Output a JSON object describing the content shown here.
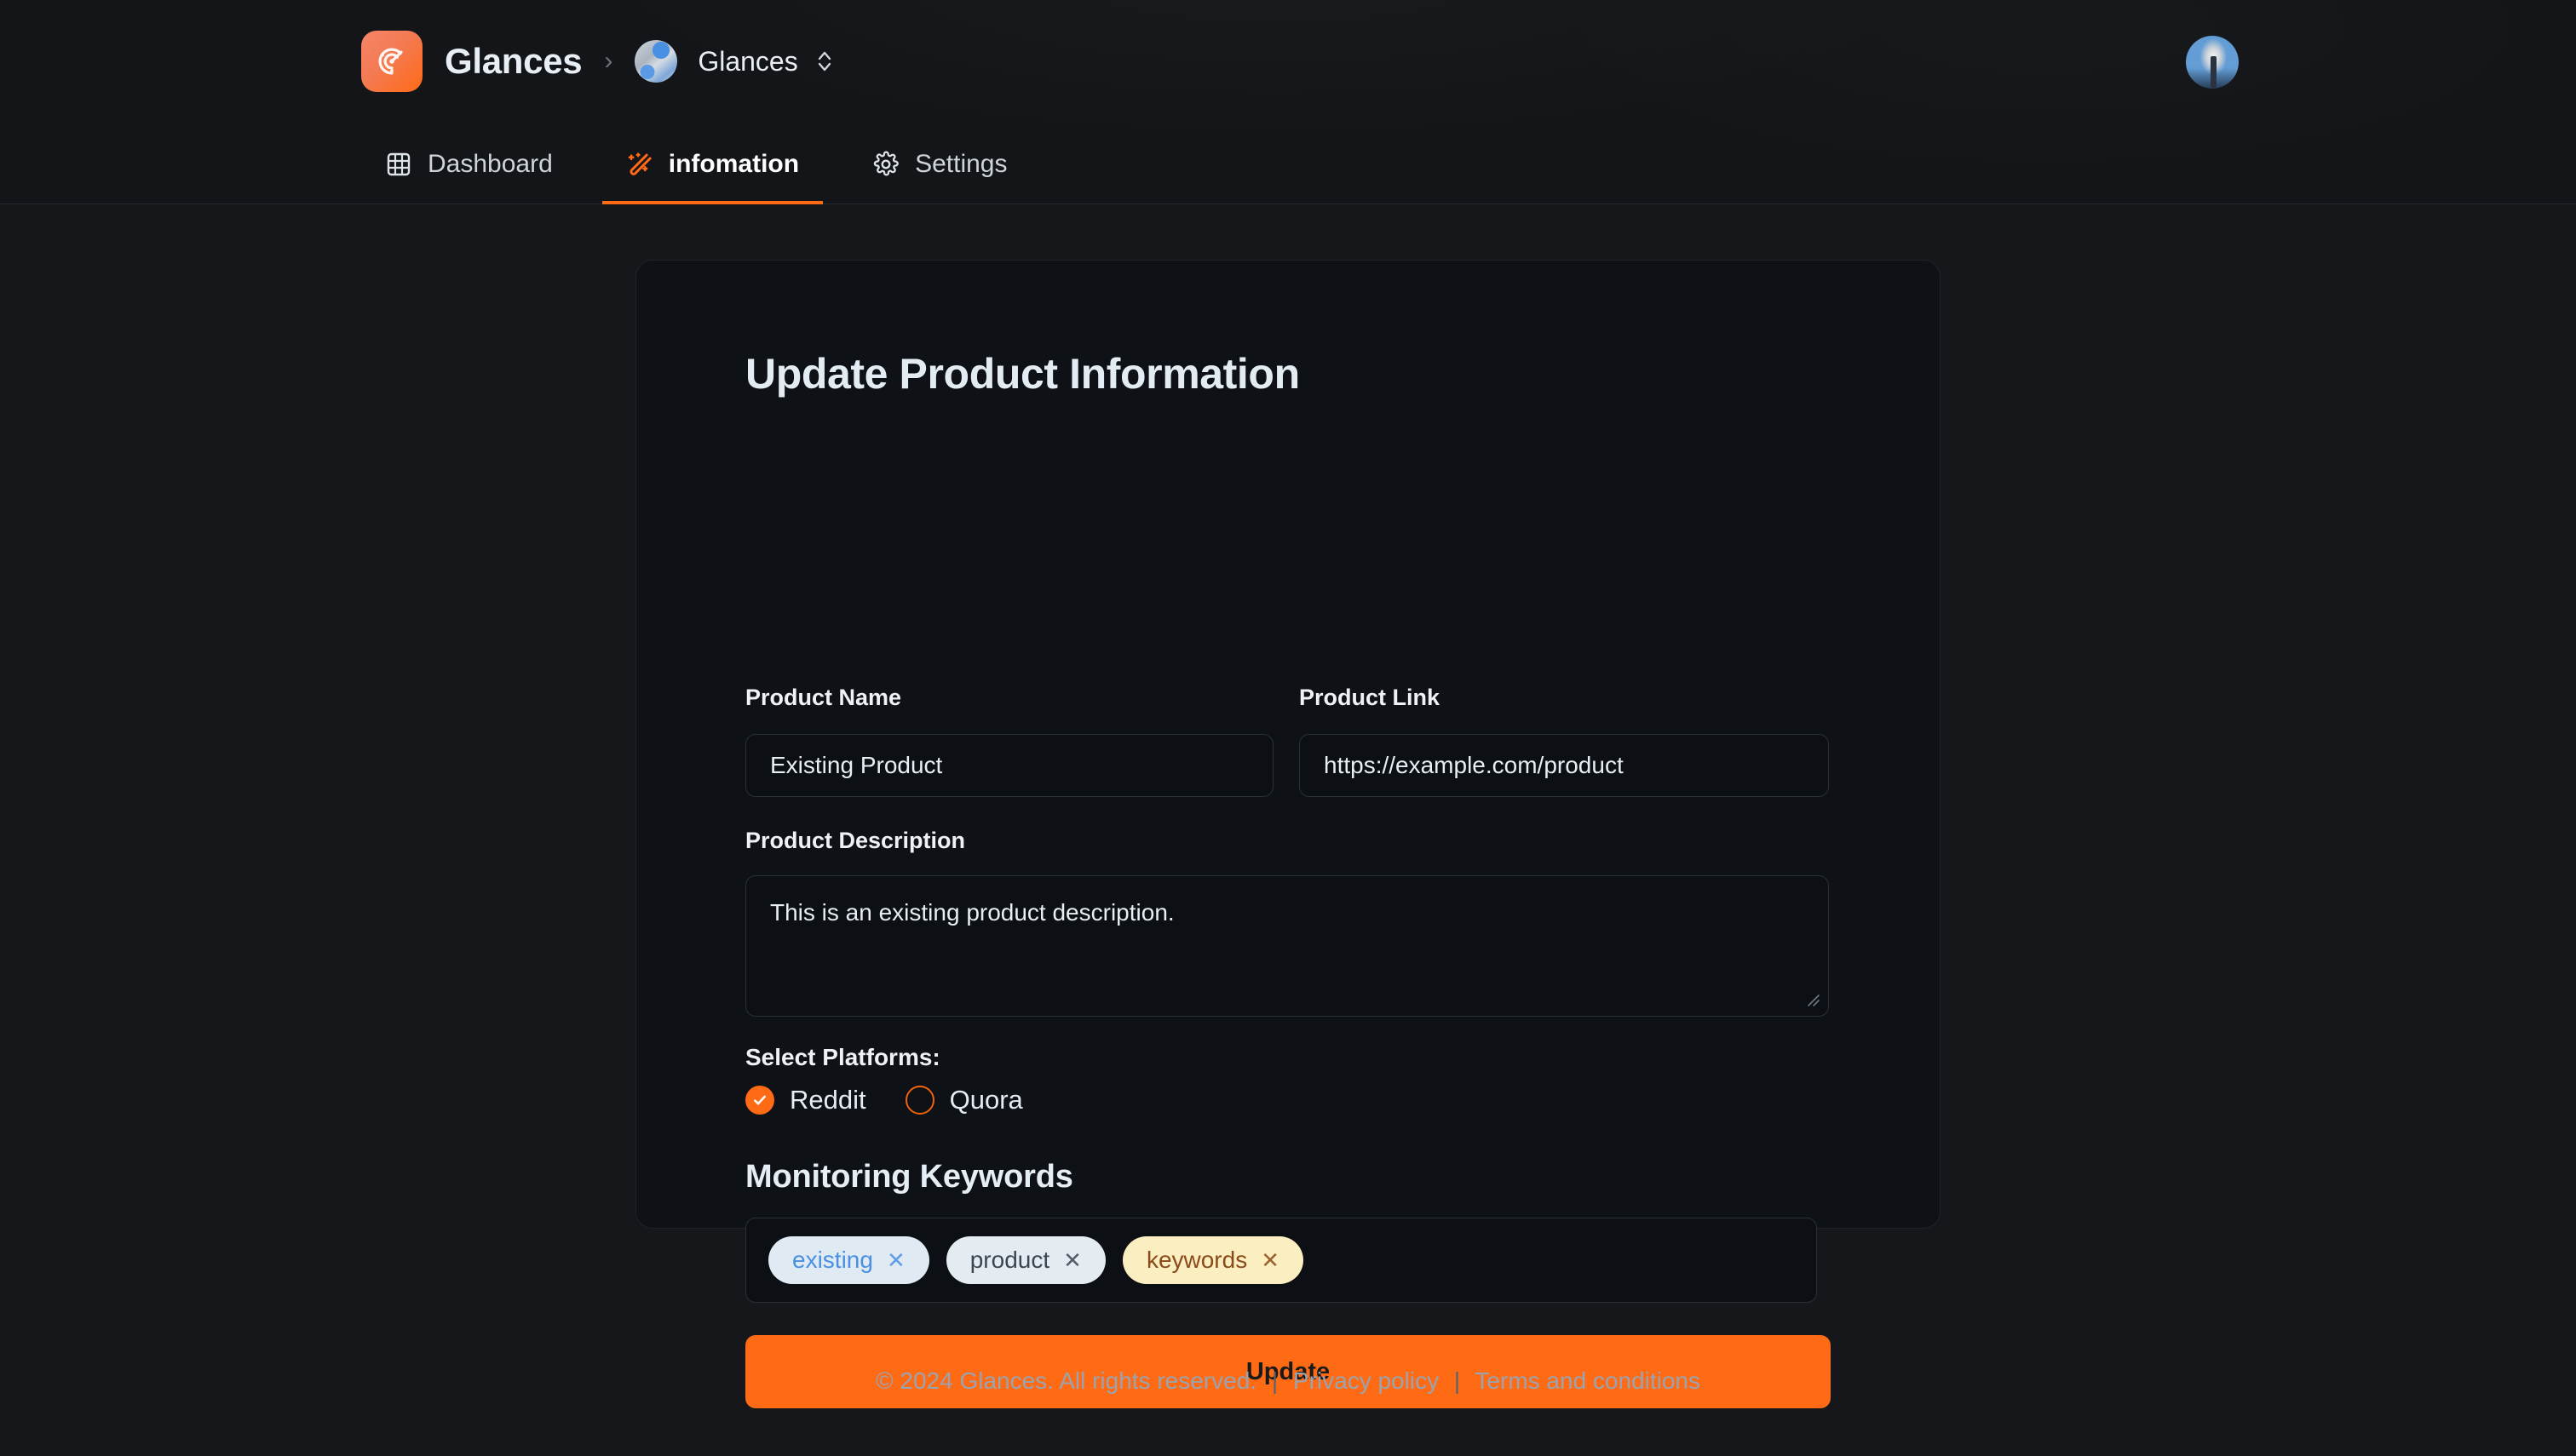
{
  "header": {
    "logo_icon": "radar-target-icon",
    "brand": "Glances",
    "breadcrumb_separator": "›",
    "workspace": "Glances",
    "workspace_switch_icon": "chevron-up-down-icon",
    "user_avatar": "user-avatar"
  },
  "tabs": [
    {
      "label": "Dashboard",
      "icon": "grid-icon",
      "active": false
    },
    {
      "label": "infomation",
      "icon": "magic-wand-icon",
      "active": true
    },
    {
      "label": "Settings",
      "icon": "gear-icon",
      "active": false
    }
  ],
  "card": {
    "title": "Update Product Information",
    "fields": {
      "product_name": {
        "label": "Product Name",
        "value": "Existing Product",
        "placeholder": "Product Name"
      },
      "product_link": {
        "label": "Product Link",
        "value": "https://example.com/product",
        "placeholder": "Product Link"
      },
      "product_description": {
        "label": "Product Description",
        "value": "This is an existing product description.",
        "placeholder": "Product Description"
      }
    },
    "platforms": {
      "label": "Select Platforms:",
      "options": [
        {
          "name": "Reddit",
          "checked": true
        },
        {
          "name": "Quora",
          "checked": false
        }
      ]
    },
    "keywords": {
      "title": "Monitoring Keywords",
      "remove_icon": "close-x-icon",
      "tags": [
        {
          "text": "existing",
          "bg": "#dfeaf3",
          "fg": "#4a90e2"
        },
        {
          "text": "product",
          "bg": "#e4ecf2",
          "fg": "#3a4652"
        },
        {
          "text": "keywords",
          "bg": "#fbefc2",
          "fg": "#8a4a1a"
        }
      ]
    },
    "submit_label": "Update"
  },
  "footer": {
    "copyright": "© 2024 Glances. All rights reserved.",
    "links": [
      "Privacy policy",
      "Terms and conditions"
    ],
    "separator": "|"
  },
  "colors": {
    "accent": "#ff6a15",
    "page_bg": "#15171a",
    "header_bg": "#131518",
    "card_bg": "#0e1116",
    "input_bg": "#0c0f14",
    "border": "#2b3038",
    "text": "#e8eef5",
    "muted": "#9aa3ae"
  }
}
